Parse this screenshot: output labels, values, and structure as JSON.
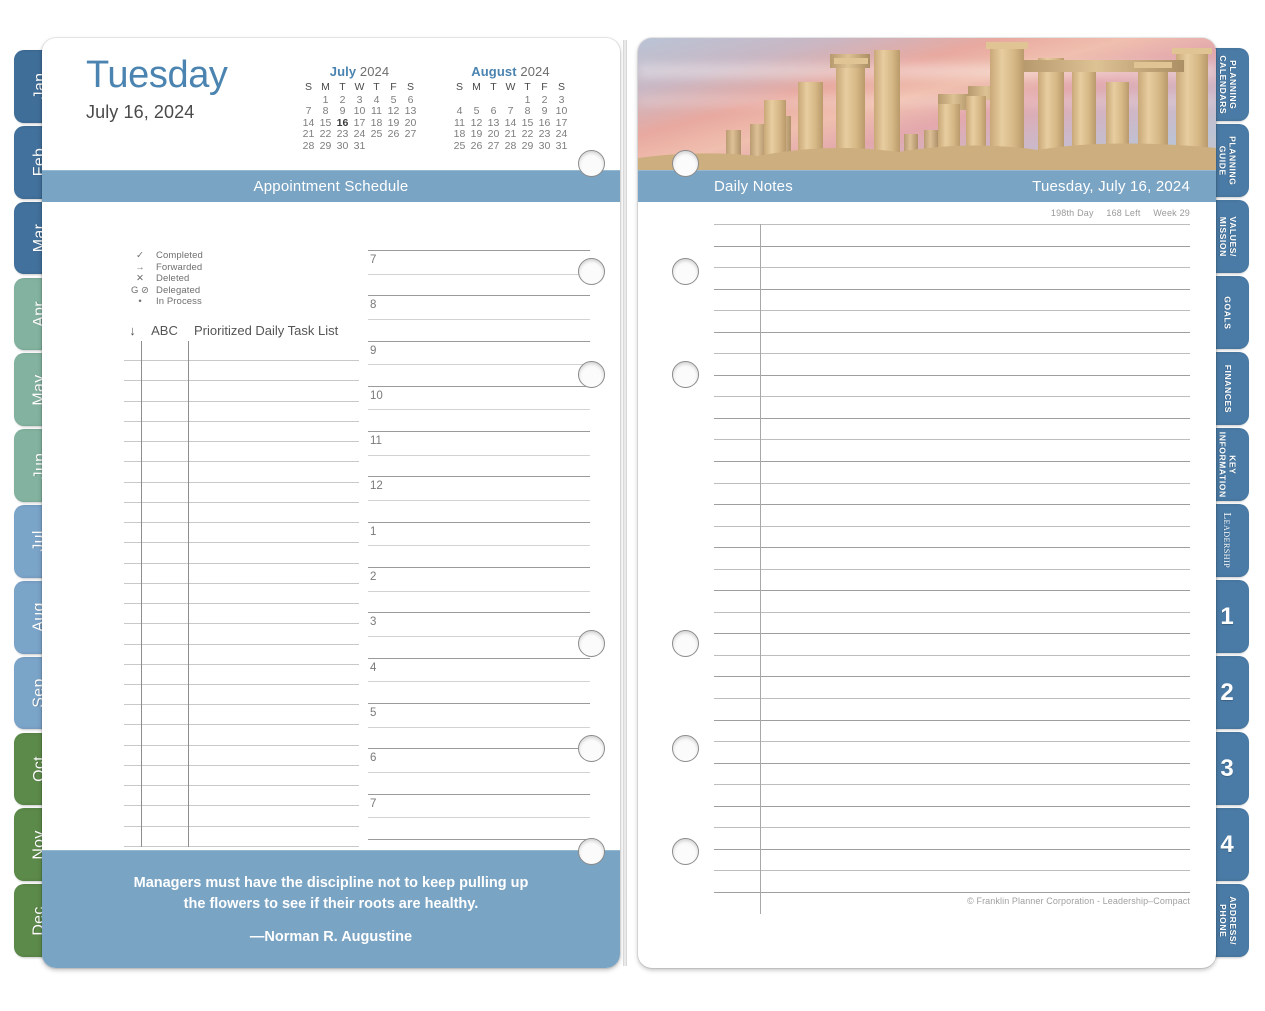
{
  "left_page": {
    "day_name": "Tuesday",
    "day_date": "July 16, 2024",
    "section_title": "Appointment Schedule",
    "mini_calendars": [
      {
        "month": "July",
        "year": "2024",
        "weekday_headers": [
          "S",
          "M",
          "T",
          "W",
          "T",
          "F",
          "S"
        ],
        "weeks": [
          [
            "",
            "1",
            "2",
            "3",
            "4",
            "5",
            "6"
          ],
          [
            "7",
            "8",
            "9",
            "10",
            "11",
            "12",
            "13"
          ],
          [
            "14",
            "15",
            "16",
            "17",
            "18",
            "19",
            "20"
          ],
          [
            "21",
            "22",
            "23",
            "24",
            "25",
            "26",
            "27"
          ],
          [
            "28",
            "29",
            "30",
            "31",
            "",
            "",
            ""
          ]
        ],
        "highlight_day": "16"
      },
      {
        "month": "August",
        "year": "2024",
        "weekday_headers": [
          "S",
          "M",
          "T",
          "W",
          "T",
          "F",
          "S"
        ],
        "weeks": [
          [
            "",
            "",
            "",
            "",
            "1",
            "2",
            "3"
          ],
          [
            "4",
            "5",
            "6",
            "7",
            "8",
            "9",
            "10"
          ],
          [
            "11",
            "12",
            "13",
            "14",
            "15",
            "16",
            "17"
          ],
          [
            "18",
            "19",
            "20",
            "21",
            "22",
            "23",
            "24"
          ],
          [
            "25",
            "26",
            "27",
            "28",
            "29",
            "30",
            "31"
          ]
        ],
        "highlight_day": ""
      }
    ],
    "legend": [
      {
        "symbol": "✓",
        "label": "Completed"
      },
      {
        "symbol": "→",
        "label": "Forwarded"
      },
      {
        "symbol": "✕",
        "label": "Deleted"
      },
      {
        "symbol": "G ⊘",
        "label": "Delegated"
      },
      {
        "symbol": "•",
        "label": "In Process"
      }
    ],
    "task_list": {
      "arrow_header": "↓",
      "abc_header": "ABC",
      "title": "Prioritized Daily Task List",
      "row_count": 25
    },
    "appointment_hours": [
      "7",
      "8",
      "9",
      "10",
      "11",
      "12",
      "1",
      "2",
      "3",
      "4",
      "5",
      "6",
      "7"
    ],
    "quote": {
      "text": "Managers must have the discipline not to keep pulling up the flowers to see if their roots are healthy.",
      "author": "—Norman R. Augustine"
    }
  },
  "right_page": {
    "section_title": "Daily Notes",
    "header_date": "Tuesday, July 16, 2024",
    "meta": {
      "day_of_year": "198th Day",
      "days_left": "168 Left",
      "week": "Week 29"
    },
    "photo_alt": "greek-temple-ruins-at-sunset",
    "note_line_count": 32,
    "credit": "© Franklin Planner Corporation - Leadership–Compact"
  },
  "month_tabs": [
    {
      "label": "Jan",
      "color": "#3f6e99"
    },
    {
      "label": "Feb",
      "color": "#41719c"
    },
    {
      "label": "Mar",
      "color": "#41719c"
    },
    {
      "label": "Apr",
      "color": "#83b3a0"
    },
    {
      "label": "May",
      "color": "#83b3a0"
    },
    {
      "label": "Jun",
      "color": "#83b3a0"
    },
    {
      "label": "Jul",
      "color": "#7ba4c9"
    },
    {
      "label": "Aug",
      "color": "#7ba4c9"
    },
    {
      "label": "Sep",
      "color": "#7ba4c9"
    },
    {
      "label": "Oct",
      "color": "#5c8a4a"
    },
    {
      "label": "Nov",
      "color": "#5c8a4a"
    },
    {
      "label": "Dec",
      "color": "#5c8a4a"
    }
  ],
  "section_tabs": [
    {
      "label": "PLANNING\nCALENDARS",
      "style": "text"
    },
    {
      "label": "PLANNING\nGUIDE",
      "style": "text"
    },
    {
      "label": "VALUES/\nMISSION",
      "style": "text"
    },
    {
      "label": "GOALS",
      "style": "text"
    },
    {
      "label": "FINANCES",
      "style": "text"
    },
    {
      "label": "KEY\nINFORMATION",
      "style": "text"
    },
    {
      "label": "Leadership",
      "style": "serif"
    },
    {
      "label": "1",
      "style": "num"
    },
    {
      "label": "2",
      "style": "num"
    },
    {
      "label": "3",
      "style": "num"
    },
    {
      "label": "4",
      "style": "num"
    },
    {
      "label": "ADDRESS/\nPHONE",
      "style": "text"
    }
  ],
  "colors": {
    "accent_blue": "#7aa4c4",
    "title_blue": "#4b84b0",
    "tab_blue": "#4a7ba6"
  }
}
